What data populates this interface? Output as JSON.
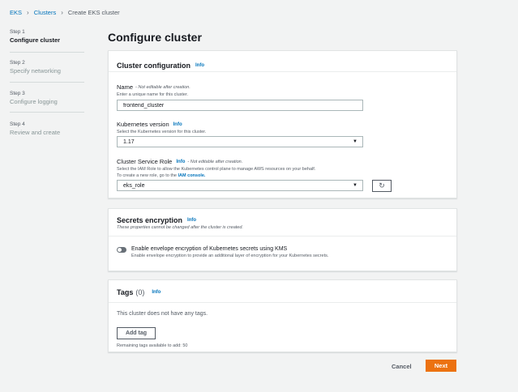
{
  "breadcrumb": {
    "root": "EKS",
    "parent": "Clusters",
    "current": "Create EKS cluster"
  },
  "steps": [
    {
      "num": "Step 1",
      "title": "Configure cluster"
    },
    {
      "num": "Step 2",
      "title": "Specify networking"
    },
    {
      "num": "Step 3",
      "title": "Configure logging"
    },
    {
      "num": "Step 4",
      "title": "Review and create"
    }
  ],
  "page": {
    "title": "Configure cluster"
  },
  "cluster_config": {
    "title": "Cluster configuration",
    "info": "Info",
    "name": {
      "label": "Name",
      "note": "- Not editable after creation.",
      "desc": "Enter a unique name for this cluster.",
      "value": "frontend_cluster"
    },
    "version": {
      "label": "Kubernetes version",
      "info": "Info",
      "desc": "Select the Kubernetes version for this cluster.",
      "value": "1.17"
    },
    "role": {
      "label": "Cluster Service Role",
      "info": "Info",
      "note": "- Not editable after creation.",
      "desc1": "Select the IAM Role to allow the Kubernetes control plane to manage AWS resources on your behalf.",
      "desc2_prefix": "To create a new role, go to the",
      "desc2_link": "IAM console.",
      "value": "eks_role"
    }
  },
  "secrets": {
    "title": "Secrets encryption",
    "info": "Info",
    "subtitle": "These properties cannot be changed after the cluster is created.",
    "toggle_label": "Enable envelope encryption of Kubernetes secrets using KMS",
    "toggle_desc": "Enable envelope encryption to provide an additional layer of encryption for your Kubernetes secrets.",
    "enabled": false
  },
  "tags": {
    "title": "Tags",
    "count": "(0)",
    "info": "Info",
    "empty": "This cluster does not have any tags.",
    "add_label": "Add tag",
    "remaining": "Remaining tags available to add: 50"
  },
  "footer": {
    "cancel": "Cancel",
    "next": "Next"
  },
  "colors": {
    "accent": "#ec7211",
    "link": "#0073bb",
    "background": "#f2f3f3"
  }
}
